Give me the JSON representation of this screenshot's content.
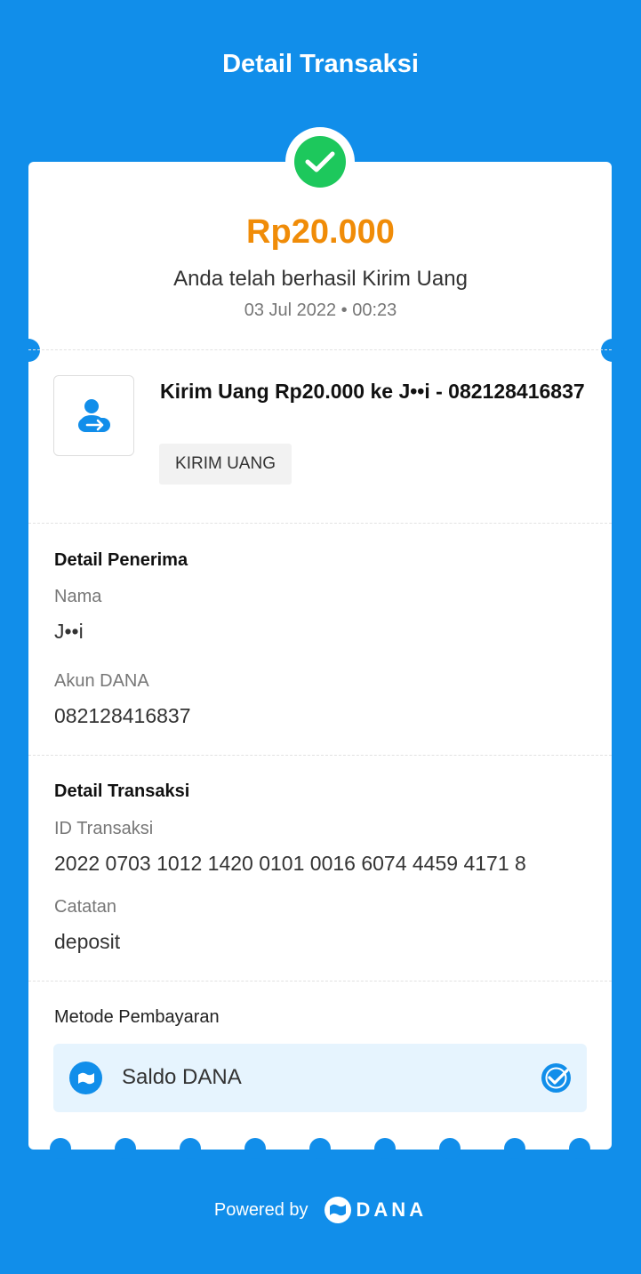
{
  "header": {
    "title": "Detail Transaksi"
  },
  "summary": {
    "amount": "Rp20.000",
    "message": "Anda telah berhasil Kirim Uang",
    "datetime": "03 Jul 2022 • 00:23"
  },
  "transaction": {
    "icon": "send-money-icon",
    "title": "Kirim Uang Rp20.000 ke J••i - 082128416837",
    "badge": "KIRIM UANG"
  },
  "recipient": {
    "section_title": "Detail Penerima",
    "name_label": "Nama",
    "name_value": "J••i",
    "account_label": "Akun DANA",
    "account_value": "082128416837"
  },
  "details": {
    "section_title": "Detail Transaksi",
    "id_label": "ID Transaksi",
    "id_value": "2022 0703 1012 1420 0101 0016 6074 4459 4171 8",
    "note_label": "Catatan",
    "note_value": "deposit"
  },
  "payment": {
    "label": "Metode Pembayaran",
    "method": "Saldo DANA",
    "method_icon": "dana-wallet-icon",
    "selected_icon": "check-badge-icon"
  },
  "footer": {
    "powered_by": "Powered by",
    "brand": "DANA"
  },
  "colors": {
    "background": "#118EEA",
    "amount": "#F08C08",
    "success": "#1DC85C"
  }
}
